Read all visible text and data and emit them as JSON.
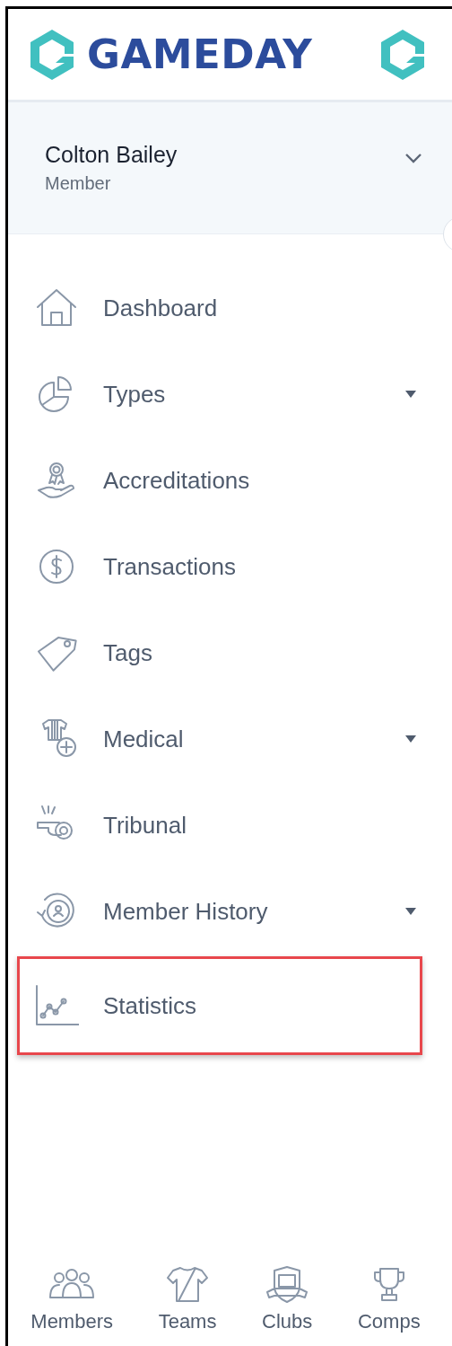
{
  "logo": {
    "text": "GAMEDAY"
  },
  "user": {
    "name": "Colton Bailey",
    "role": "Member"
  },
  "menu": [
    {
      "label": "Dashboard",
      "has_submenu": false,
      "highlighted": false
    },
    {
      "label": "Types",
      "has_submenu": true,
      "highlighted": false
    },
    {
      "label": "Accreditations",
      "has_submenu": false,
      "highlighted": false
    },
    {
      "label": "Transactions",
      "has_submenu": false,
      "highlighted": false
    },
    {
      "label": "Tags",
      "has_submenu": false,
      "highlighted": false
    },
    {
      "label": "Medical",
      "has_submenu": true,
      "highlighted": false
    },
    {
      "label": "Tribunal",
      "has_submenu": false,
      "highlighted": false
    },
    {
      "label": "Member History",
      "has_submenu": true,
      "highlighted": false
    },
    {
      "label": "Statistics",
      "has_submenu": false,
      "highlighted": true
    }
  ],
  "bottom_nav": [
    {
      "label": "Members"
    },
    {
      "label": "Teams"
    },
    {
      "label": "Clubs"
    },
    {
      "label": "Comps"
    }
  ]
}
